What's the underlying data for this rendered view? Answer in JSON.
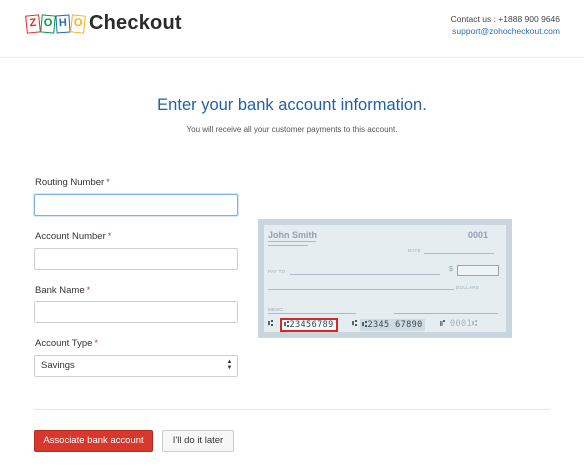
{
  "header": {
    "logo_tiles": [
      "Z",
      "O",
      "H",
      "O"
    ],
    "logo_text": "Checkout",
    "contact_line": "Contact us : +1888 900 9646",
    "support_email": "support@zohocheckout.com"
  },
  "main": {
    "heading": "Enter your bank account information.",
    "subheading": "You will receive all your customer payments to this account."
  },
  "form": {
    "routing": {
      "label": "Routing Number",
      "required_mark": "*",
      "value": ""
    },
    "account": {
      "label": "Account Number",
      "required_mark": "*",
      "value": ""
    },
    "bank": {
      "label": "Bank Name",
      "required_mark": "*",
      "value": ""
    },
    "type": {
      "label": "Account Type",
      "required_mark": "*",
      "selected": "Savings"
    }
  },
  "check": {
    "holder_name": "John Smith",
    "check_number": "0001",
    "date_label": "DATE",
    "payto_label": "PAY TO",
    "dollar_sign": "$",
    "dollars_label": "DOLLARS",
    "memo_label": "MEMO",
    "micr_lead": "⑆",
    "micr_routing": "⑆23456789",
    "micr_sep": "⑆",
    "micr_account": "⑆2345 67890",
    "micr_tail_sym": "⑈",
    "micr_tail": "0001⑆"
  },
  "actions": {
    "primary_label": "Associate bank account",
    "secondary_label": "I'll do it later"
  },
  "colors": {
    "accent_blue": "#2260a8",
    "primary_button": "#d8382c",
    "highlight": "#d8272b"
  }
}
